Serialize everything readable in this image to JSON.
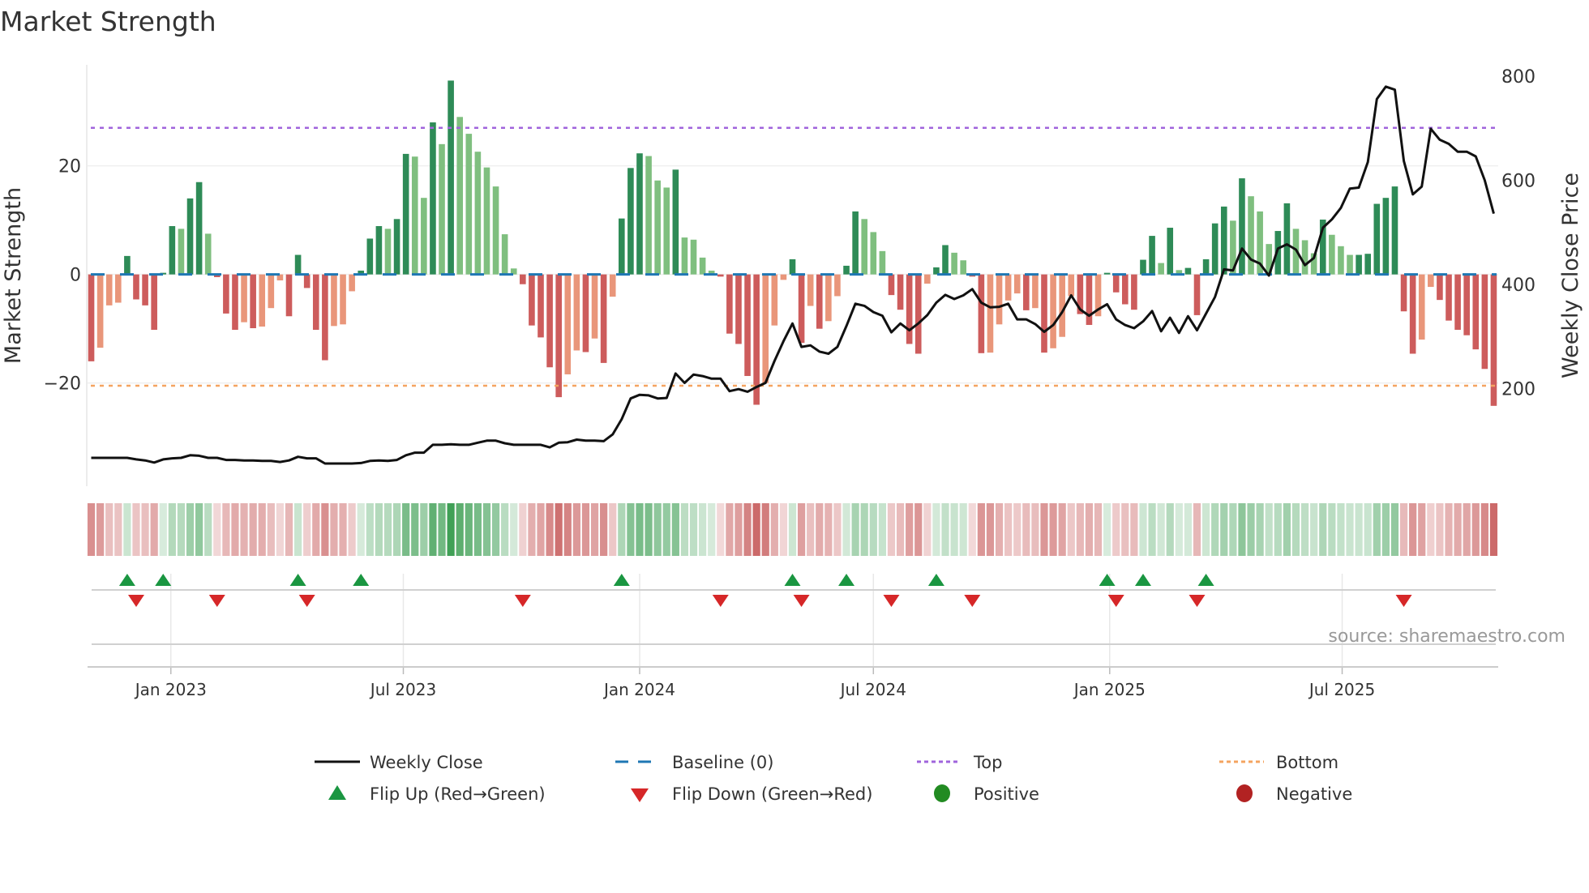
{
  "title": "Market Strength",
  "source": "source: sharemaestro.com",
  "colors": {
    "pos_strong": "#2e8b57",
    "pos_weak": "#7fbf7f",
    "neg_strong": "#cd5c5c",
    "neg_weak": "#e9967a",
    "strip_pos": "#3f9f55",
    "strip_neg": "#cc6a6a",
    "baseline": "#1f77b4",
    "top": "#a064dc",
    "bottom": "#f4a460",
    "price": "#111111",
    "flip_up": "#1a9641",
    "flip_down": "#d62728",
    "positive": "#228b22",
    "negative": "#b22222",
    "source": "#999999"
  },
  "chart_data": {
    "type": "bar",
    "title": "Market Strength",
    "x_start": "2022-10-31",
    "x_frequency": "weekly",
    "ylabel": "Market Strength",
    "y2label": "Weekly Close Price",
    "ylim": [
      -39,
      38.6
    ],
    "y2lim": [
      12.5,
      821.8
    ],
    "y_ticks": [
      {
        "value": 20,
        "label": "20"
      },
      {
        "value": 0,
        "label": "0"
      },
      {
        "value": -20,
        "label": "−20"
      }
    ],
    "y2_ticks": [
      {
        "value": 800,
        "label": "800"
      },
      {
        "value": 600,
        "label": "600"
      },
      {
        "value": 400,
        "label": "400"
      },
      {
        "value": 200,
        "label": "200"
      }
    ],
    "x_ticks": [
      {
        "date": "2023-01-01",
        "label": "Jan 2023"
      },
      {
        "date": "2023-07-01",
        "label": "Jul 2023"
      },
      {
        "date": "2024-01-01",
        "label": "Jan 2024"
      },
      {
        "date": "2024-07-01",
        "label": "Jul 2024"
      },
      {
        "date": "2025-01-01",
        "label": "Jan 2025"
      },
      {
        "date": "2025-07-01",
        "label": "Jul 2025"
      }
    ],
    "grid": true,
    "reference_lines": {
      "top": 27,
      "bottom": -20.5,
      "baseline": 0
    },
    "series": [
      {
        "name": "Market Strength",
        "type": "bar",
        "values": [
          -16,
          -13.5,
          -5.7,
          -5.2,
          3.4,
          -4.6,
          -5.7,
          -10.2,
          0.3,
          8.9,
          8.4,
          14,
          17,
          7.5,
          -0.5,
          -7.2,
          -10.2,
          -8.8,
          -9.9,
          -9.6,
          -6.2,
          -1.1,
          -7.7,
          3.6,
          -2.5,
          -10.2,
          -15.8,
          -9.5,
          -9.2,
          -3.1,
          0.7,
          6.6,
          8.9,
          8.4,
          10.2,
          22.2,
          21.7,
          14.1,
          28,
          24,
          35.7,
          29,
          25.9,
          22.6,
          19.7,
          16.2,
          7.4,
          1.1,
          -1.8,
          -9.4,
          -11.6,
          -17.1,
          -22.6,
          -18.4,
          -14,
          -14.3,
          -11.8,
          -16.3,
          -4.1,
          10.3,
          19.6,
          22.3,
          21.8,
          17.3,
          16,
          19.3,
          6.8,
          6.4,
          3.1,
          0.7,
          -0.4,
          -10.9,
          -12.8,
          -18.7,
          -24,
          -20,
          -9.4,
          -1,
          2.8,
          -12.6,
          -5.8,
          -10,
          -8.6,
          -4,
          1.6,
          11.6,
          10.2,
          7.8,
          4.3,
          -3.8,
          -6.5,
          -12.8,
          -14.6,
          -1.7,
          1.3,
          5.4,
          4,
          2.6,
          -0.4,
          -14.5,
          -14.4,
          -9.2,
          -4.8,
          -3.5,
          -6.6,
          -6.2,
          -14.4,
          -13.6,
          -11.5,
          -4,
          -7.3,
          -9.3,
          -7.7,
          0.3,
          -3.3,
          -5.5,
          -6.5,
          2.7,
          7.1,
          2.1,
          8.6,
          0.8,
          1.2,
          -7.5,
          2.8,
          9.4,
          12.5,
          9.9,
          17.7,
          14.4,
          11.6,
          5.6,
          8,
          13.1,
          8.4,
          6.3,
          3.9,
          10.1,
          7.3,
          5.2,
          3.6,
          3.6,
          3.8,
          13,
          14.1,
          16.2,
          -6.8,
          -14.6,
          -12,
          -2.3,
          -4.7,
          -8.5,
          -10.2,
          -11.2,
          -13.8,
          -17.4,
          -24.2
        ]
      },
      {
        "name": "Weekly Close",
        "type": "line",
        "axis": "right",
        "values": [
          67,
          67,
          67,
          67,
          67,
          64,
          62,
          58,
          64,
          66,
          67,
          72,
          71,
          67,
          67,
          63,
          63,
          62,
          62,
          61,
          61,
          59,
          62,
          69,
          66,
          66,
          56,
          56,
          56,
          56,
          57,
          61,
          62,
          61,
          63,
          72,
          77,
          77,
          92,
          92,
          93,
          92,
          92,
          96,
          100,
          100,
          95,
          92,
          92,
          92,
          92,
          87,
          96,
          97,
          102,
          100,
          100,
          99,
          112,
          141,
          181,
          188,
          187,
          181,
          182,
          229,
          211,
          227,
          224,
          219,
          219,
          195,
          199,
          194,
          203,
          211,
          253,
          291,
          325,
          280,
          283,
          271,
          267,
          280,
          320,
          363,
          359,
          347,
          340,
          308,
          325,
          312,
          325,
          341,
          365,
          380,
          372,
          379,
          391,
          365,
          356,
          357,
          363,
          333,
          333,
          324,
          309,
          322,
          347,
          379,
          352,
          340,
          352,
          362,
          333,
          322,
          316,
          329,
          349,
          310,
          336,
          307,
          339,
          312,
          344,
          376,
          429,
          427,
          469,
          448,
          440,
          417,
          469,
          477,
          467,
          437,
          451,
          509,
          525,
          547,
          584,
          586,
          635,
          756,
          780,
          774,
          637,
          573,
          588,
          699,
          678,
          670,
          655,
          655,
          646,
          600,
          536
        ]
      }
    ],
    "flip_up_weeks": [
      4,
      8,
      23,
      30,
      59,
      78,
      84,
      94,
      113,
      117,
      124
    ],
    "flip_down_weeks": [
      5,
      14,
      24,
      48,
      70,
      79,
      89,
      98,
      114,
      123,
      146
    ],
    "legend_position": "bottom",
    "legend": [
      {
        "label": "Weekly Close",
        "symbol": "line"
      },
      {
        "label": "Baseline (0)",
        "symbol": "dashed-line"
      },
      {
        "label": "Top",
        "symbol": "dotted-line"
      },
      {
        "label": "Bottom",
        "symbol": "dotted-line"
      },
      {
        "label": "Flip Up (Red→Green)",
        "symbol": "triangle-up"
      },
      {
        "label": "Flip Down (Green→Red)",
        "symbol": "triangle-down"
      },
      {
        "label": "Positive",
        "symbol": "circle"
      },
      {
        "label": "Negative",
        "symbol": "circle"
      }
    ]
  }
}
